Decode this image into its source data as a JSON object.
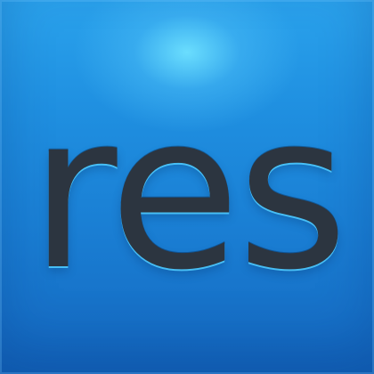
{
  "icon": {
    "wordmark": "res",
    "colors": {
      "background_top": "#2aa2ec",
      "background_bottom": "#1468c0",
      "highlight": "#6ee1ff",
      "text": "#2c3540",
      "text_edge": "#50cdff"
    }
  }
}
